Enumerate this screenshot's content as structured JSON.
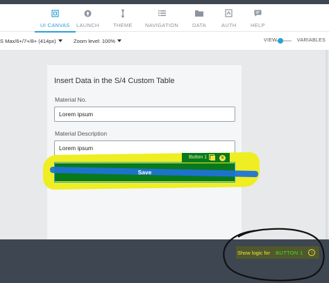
{
  "nav": {
    "items": [
      {
        "label": "UI CANVAS",
        "icon": "ui-canvas-icon",
        "active": true
      },
      {
        "label": "LAUNCH",
        "icon": "launch-icon",
        "active": false
      },
      {
        "label": "THEME",
        "icon": "theme-brush-icon",
        "active": false
      },
      {
        "label": "NAVIGATION",
        "icon": "navigation-list-icon",
        "active": false
      },
      {
        "label": "DATA",
        "icon": "data-folder-icon",
        "active": false
      },
      {
        "label": "AUTH",
        "icon": "auth-icon",
        "active": false
      },
      {
        "label": "HELP",
        "icon": "help-chat-icon",
        "active": false
      }
    ]
  },
  "toolbar": {
    "device": "S Max/6+/7+/8+ (414px)",
    "zoom": "Zoom level: 100%",
    "view_label": "VIEW",
    "variables_label": "VARIABLES"
  },
  "form": {
    "title": "Insert Data in the S/4 Custom Table",
    "fields": [
      {
        "label": "Material No.",
        "value": "Lorem ipsum"
      },
      {
        "label": "Material Description",
        "value": "Lorem ipsum"
      }
    ],
    "save_label": "Save",
    "selected_tag": "Button 1"
  },
  "bottom": {
    "show_logic_prefix": "Show logic for",
    "show_logic_target": "BUTTON 1"
  },
  "colors": {
    "accent": "#2a9fd8",
    "selected_green": "#087a1c",
    "highlight_yellow": "#eeee22",
    "bottom_bar": "#3d4651"
  }
}
